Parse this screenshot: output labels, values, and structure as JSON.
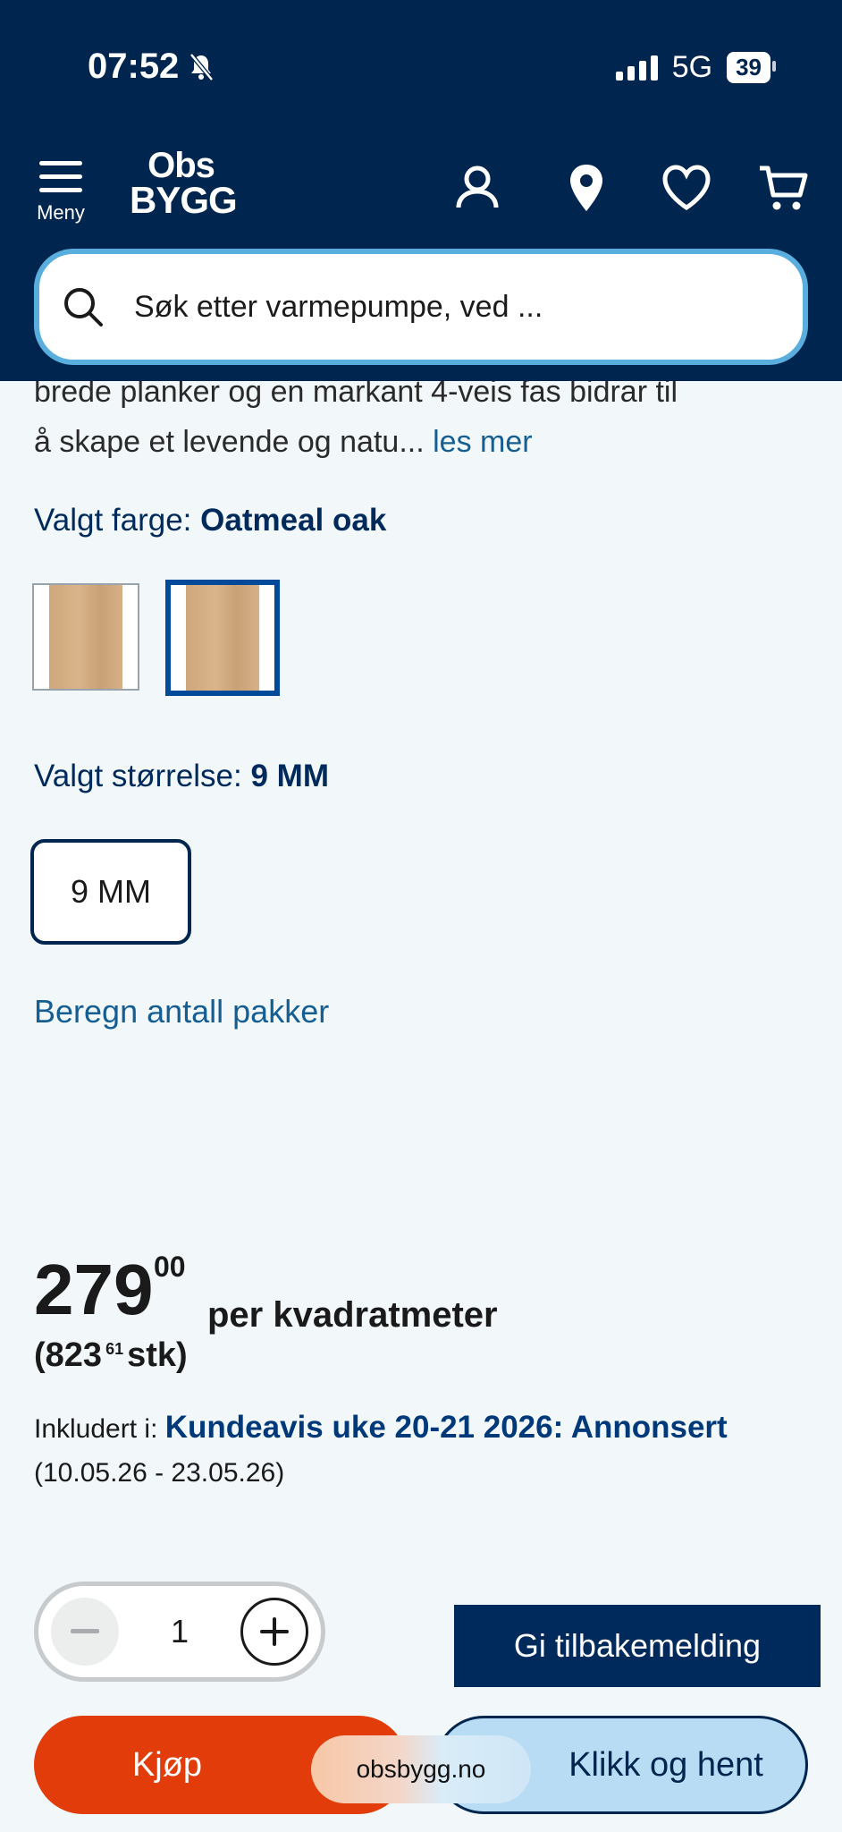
{
  "status": {
    "time": "07:52",
    "network": "5G",
    "battery": "39"
  },
  "header": {
    "menu_label": "Meny",
    "logo_line1": "Obs",
    "logo_line2": "BYGG"
  },
  "search": {
    "placeholder": "Søk etter varmepumpe, ved ..."
  },
  "description": {
    "text_line1": "brede planker og en markant 4-veis fas bidrar til",
    "text_line2": "å skape et levende og natu...",
    "more_link": "les mer"
  },
  "color": {
    "label": "Valgt farge:",
    "value": "Oatmeal oak"
  },
  "size": {
    "label": "Valgt størrelse:",
    "value": "9 MM",
    "option": "9 MM"
  },
  "calc_link": "Beregn antall pakker",
  "price": {
    "main": "279",
    "decimals": "00",
    "per_unit": "per kvadratmeter",
    "stk_open": "(823",
    "stk_decimals": "61",
    "stk_close": "stk)"
  },
  "campaign": {
    "prefix": "Inkludert i:",
    "link": "Kundeavis uke 20-21 2026: Annonsert",
    "dates": "(10.05.26 - 23.05.26)"
  },
  "quantity": {
    "value": "1"
  },
  "buttons": {
    "feedback": "Gi tilbakemelding",
    "buy": "Kjøp",
    "click_collect": "Klikk og hent"
  },
  "browser": {
    "url": "obsbygg.no"
  }
}
